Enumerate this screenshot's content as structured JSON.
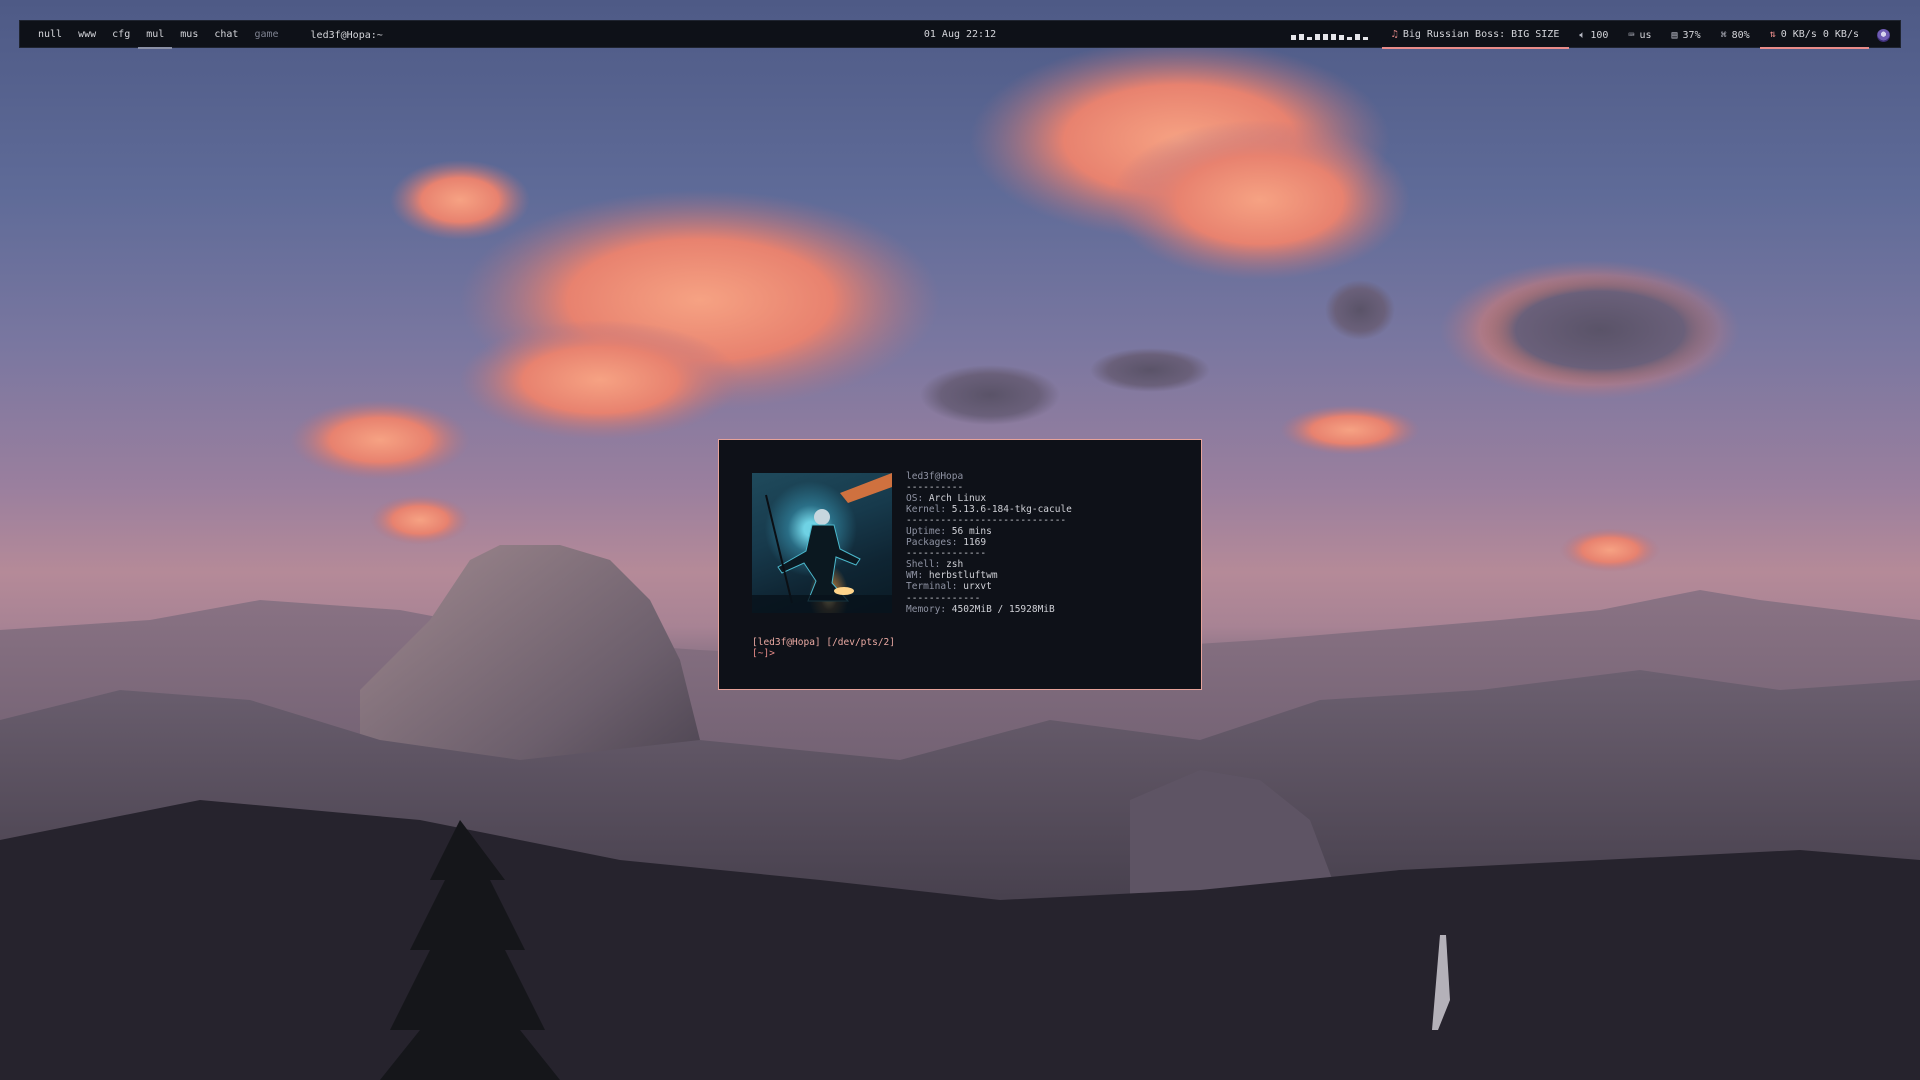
{
  "topbar": {
    "tags": [
      {
        "label": "null",
        "state": "normal"
      },
      {
        "label": "www",
        "state": "normal"
      },
      {
        "label": "cfg",
        "state": "normal"
      },
      {
        "label": "mul",
        "state": "active"
      },
      {
        "label": "mus",
        "state": "normal"
      },
      {
        "label": "chat",
        "state": "normal"
      },
      {
        "label": "game",
        "state": "dim"
      }
    ],
    "window_title": "led3f@Hopa:~",
    "clock": "01 Aug 22:12",
    "modules": {
      "music": {
        "icon": "music-note-icon",
        "text": "Big Russian Boss: BIG SIZE"
      },
      "volume": {
        "icon": "speaker-icon",
        "text": "100"
      },
      "keyboard": {
        "icon": "keyboard-icon",
        "text": "us"
      },
      "cpu": {
        "icon": "cpu-icon",
        "text": "37%"
      },
      "memory": {
        "icon": "memory-icon",
        "text": "80%"
      },
      "network": {
        "icon": "network-icon",
        "text": "0 KB/s 0 KB/s"
      }
    },
    "accent": "#e98c8a"
  },
  "terminal": {
    "user_host": "led3f@Hopa",
    "sep1": "----------",
    "os": {
      "key": "OS:",
      "value": "Arch Linux"
    },
    "kernel": {
      "key": "Kernel:",
      "value": "5.13.6-184-tkg-cacule"
    },
    "sep2": "----------------------------",
    "uptime": {
      "key": "Uptime:",
      "value": "56 mins"
    },
    "packages": {
      "key": "Packages:",
      "value": "1169"
    },
    "sep3": "--------------",
    "shell": {
      "key": "Shell:",
      "value": "zsh"
    },
    "wm": {
      "key": "WM:",
      "value": "herbstluftwm"
    },
    "terminal_app": {
      "key": "Terminal:",
      "value": "urxvt"
    },
    "sep4": "-------------",
    "memory": {
      "key": "Memory:",
      "value": "4502MiB / 15928MiB"
    },
    "prompt_line1": "[led3f@Hopa] [/dev/pts/2]",
    "prompt_line2": "[~]>",
    "border_color": "#e7a39a"
  }
}
